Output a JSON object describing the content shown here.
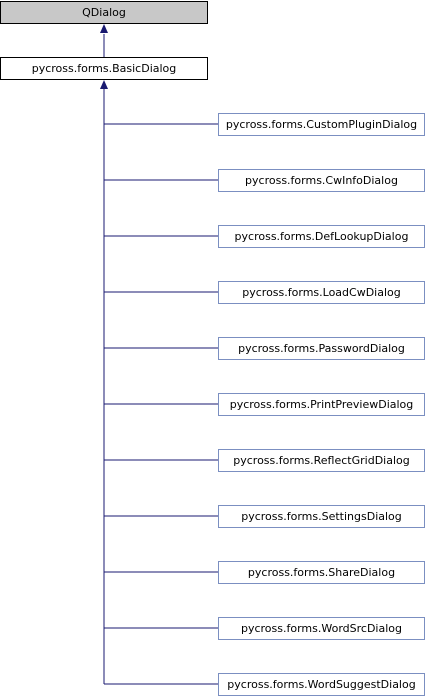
{
  "diagram": {
    "base_class": "QDialog",
    "parent_class": "pycross.forms.BasicDialog",
    "subclasses": [
      "pycross.forms.CustomPluginDialog",
      "pycross.forms.CwInfoDialog",
      "pycross.forms.DefLookupDialog",
      "pycross.forms.LoadCwDialog",
      "pycross.forms.PasswordDialog",
      "pycross.forms.PrintPreviewDialog",
      "pycross.forms.ReflectGridDialog",
      "pycross.forms.SettingsDialog",
      "pycross.forms.ShareDialog",
      "pycross.forms.WordSrcDialog",
      "pycross.forms.WordSuggestDialog"
    ],
    "colors": {
      "edge": "#191970",
      "base_fill": "#c8c8c8",
      "child_border": "#7b8fc1"
    }
  }
}
